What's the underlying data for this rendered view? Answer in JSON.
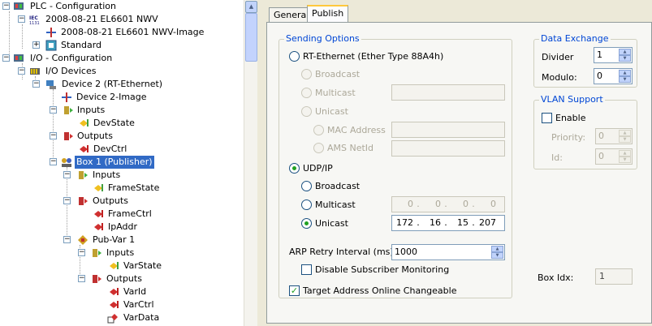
{
  "tree": {
    "plc_config": "PLC - Configuration",
    "plc_project": "2008-08-21 EL6601 NWV",
    "plc_image": "2008-08-21 EL6601 NWV-Image",
    "standard": "Standard",
    "io_config": "I/O - Configuration",
    "io_devices": "I/O Devices",
    "device2": "Device 2 (RT-Ethernet)",
    "device2_image": "Device 2-Image",
    "inputs": "Inputs",
    "devstate": "DevState",
    "outputs": "Outputs",
    "devctrl": "DevCtrl",
    "box1": "Box 1 (Publisher)",
    "box_inputs": "Inputs",
    "framestate": "FrameState",
    "box_outputs": "Outputs",
    "framectrl": "FrameCtrl",
    "ipaddr": "IpAddr",
    "pubvar": "Pub-Var 1",
    "pv_inputs": "Inputs",
    "varstate": "VarState",
    "pv_outputs": "Outputs",
    "varid": "VarId",
    "varctrl": "VarCtrl",
    "vardata": "VarData"
  },
  "tabs": {
    "general": "General",
    "publish": "Publish"
  },
  "sending": {
    "title": "Sending Options",
    "rt_ethernet": "RT-Ethernet (Ether Type 88A4h)",
    "rt_broadcast": "Broadcast",
    "rt_multicast": "Multicast",
    "rt_unicast": "Unicast",
    "mac_address": "MAC Address",
    "ams_netid": "AMS NetId",
    "udp_ip": "UDP/IP",
    "udp_broadcast": "Broadcast",
    "udp_multicast": "Multicast",
    "udp_unicast": "Unicast",
    "multicast_ip": [
      "0",
      "0",
      "0",
      "0"
    ],
    "unicast_ip": [
      "172",
      "16",
      "15",
      "207"
    ],
    "arp_label": "ARP Retry Interval (ms):",
    "arp_value": "1000",
    "disable_sub": "Disable Subscriber Monitoring",
    "target_online": "Target Address Online Changeable"
  },
  "exchange": {
    "title": "Data Exchange",
    "divider_label": "Divider",
    "divider_value": "1",
    "modulo_label": "Modulo:",
    "modulo_value": "0"
  },
  "vlan": {
    "title": "VLAN Support",
    "enable": "Enable",
    "priority_label": "Priority:",
    "priority_value": "0",
    "id_label": "Id:",
    "id_value": "0"
  },
  "box_idx": {
    "label": "Box Idx:",
    "value": "1"
  }
}
